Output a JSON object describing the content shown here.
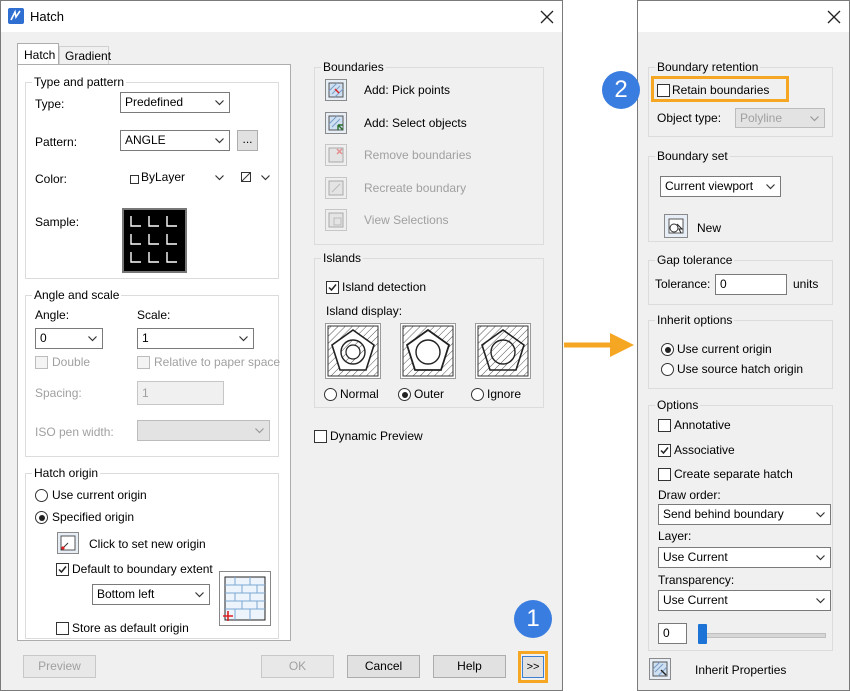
{
  "main_dialog": {
    "title": "Hatch",
    "tabs": [
      "Hatch",
      "Gradient"
    ],
    "type_and_pattern": {
      "title": "Type and pattern",
      "type_label": "Type:",
      "type_value": "Predefined",
      "pattern_label": "Pattern:",
      "pattern_value": "ANGLE",
      "pattern_browse": "...",
      "color_label": "Color:",
      "color_value": "ByLayer",
      "sample_label": "Sample:"
    },
    "angle_and_scale": {
      "title": "Angle and scale",
      "angle_label": "Angle:",
      "angle_value": "0",
      "scale_label": "Scale:",
      "scale_value": "1",
      "double_label": "Double",
      "relative_label": "Relative to paper space",
      "spacing_label": "Spacing:",
      "spacing_value": "1",
      "iso_label": "ISO pen width:"
    },
    "hatch_origin": {
      "title": "Hatch origin",
      "use_current": "Use current origin",
      "specified": "Specified origin",
      "click_to_set": "Click to set new origin",
      "default_extent": "Default to boundary extent",
      "extent_value": "Bottom left",
      "store_default": "Store as default origin"
    },
    "boundaries": {
      "title": "Boundaries",
      "items": [
        {
          "label": "Add: Pick points",
          "enabled": true
        },
        {
          "label": "Add: Select objects",
          "enabled": true
        },
        {
          "label": "Remove boundaries",
          "enabled": false
        },
        {
          "label": "Recreate boundary",
          "enabled": false
        },
        {
          "label": "View Selections",
          "enabled": false
        }
      ]
    },
    "islands": {
      "title": "Islands",
      "detection": "Island detection",
      "display_label": "Island display:",
      "options": [
        "Normal",
        "Outer",
        "Ignore"
      ],
      "selected": "Outer"
    },
    "dynamic_preview": "Dynamic Preview",
    "buttons": {
      "preview": "Preview",
      "ok": "OK",
      "cancel": "Cancel",
      "help": "Help",
      "expand": ">>"
    }
  },
  "extended_panel": {
    "boundary_retention": {
      "title": "Boundary retention",
      "retain": "Retain boundaries",
      "object_type_label": "Object type:",
      "object_type_value": "Polyline"
    },
    "boundary_set": {
      "title": "Boundary set",
      "value": "Current viewport",
      "new_label": "New"
    },
    "gap_tolerance": {
      "title": "Gap tolerance",
      "label": "Tolerance:",
      "value": "0",
      "units": "units"
    },
    "inherit_options": {
      "title": "Inherit options",
      "use_current": "Use current origin",
      "use_source": "Use source hatch origin"
    },
    "options": {
      "title": "Options",
      "annotative": "Annotative",
      "associative": "Associative",
      "separate": "Create separate hatch",
      "draw_order_label": "Draw order:",
      "draw_order_value": "Send behind boundary",
      "layer_label": "Layer:",
      "layer_value": "Use Current",
      "transparency_label": "Transparency:",
      "transparency_combo": "Use Current",
      "transparency_value": "0",
      "transparency_level": 0
    },
    "inherit_properties": "Inherit Properties"
  },
  "callouts": {
    "badge1": "1",
    "badge2": "2"
  },
  "colors": {
    "highlight": "#f5a623",
    "badge": "#3a7de0"
  }
}
